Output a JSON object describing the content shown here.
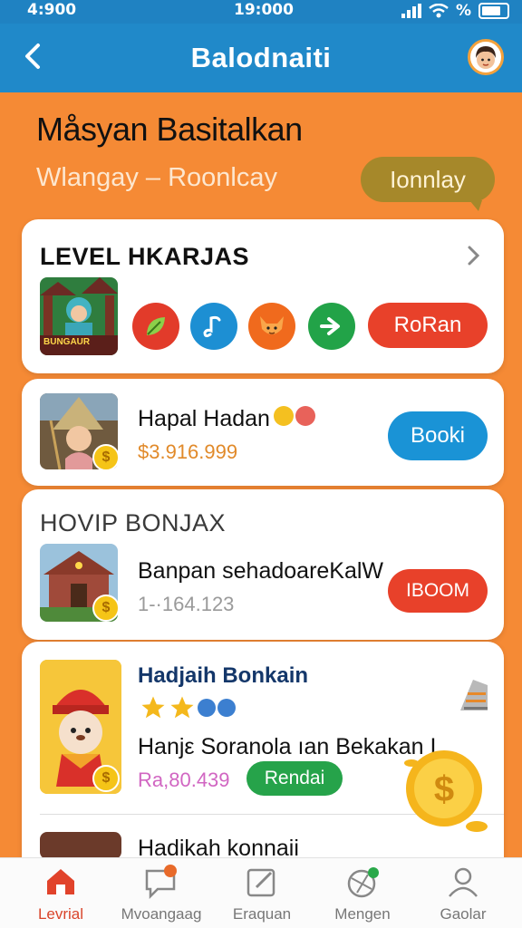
{
  "status_bar": {
    "left": "4:900",
    "time": "19:000",
    "right": "%"
  },
  "app_bar": {
    "title": "Balodnaiti"
  },
  "hero": {
    "title": "Måsyan Basitalkan",
    "subtitle": "Wlangay – Roonlcay",
    "pill_label": "Ionnlay"
  },
  "level_card": {
    "title": "LEVEL HKARJAS",
    "thumb_caption": "BUNGAUR",
    "action_label": "RoRan"
  },
  "item1": {
    "title": "Hapal Hadan",
    "price": "$3.916.999",
    "button": "Booki"
  },
  "bonus_section": {
    "title": "HOVIP BONJAX",
    "item_title": "Banpan sehadoareKalW",
    "item_value": "1-·164.123",
    "button": "IBOOM"
  },
  "promo": {
    "title": "Hadjaih Bonkain",
    "description": "Hanjε Soranola ıan Bekakan I",
    "price": "Ra,80.439",
    "pill_label": "Rendai"
  },
  "partial_item": {
    "title": "Hadikah konnaii"
  },
  "bottom_nav": [
    {
      "label": "Levrial",
      "icon": "home-icon",
      "active": true
    },
    {
      "label": "Mvoangaag",
      "icon": "chat-icon",
      "active": false
    },
    {
      "label": "Eraquan",
      "icon": "edit-icon",
      "active": false
    },
    {
      "label": "Mengen",
      "icon": "globe-icon",
      "active": false
    },
    {
      "label": "Gaolar",
      "icon": "profile-icon",
      "active": false
    }
  ],
  "colors": {
    "primary_blue": "#2089c9",
    "background_orange": "#f58a35",
    "action_red": "#e8412a",
    "action_blue": "#1a93d6",
    "promo_green": "#26a34a"
  }
}
